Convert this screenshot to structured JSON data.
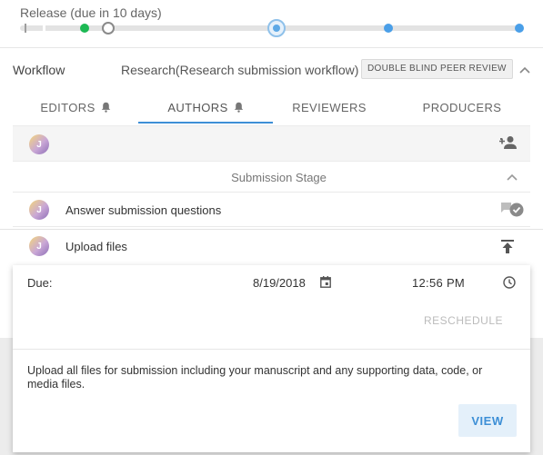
{
  "release": {
    "label": "Release (due in 10 days)"
  },
  "workflow": {
    "label": "Workflow",
    "name": "Research(Research submission workflow)",
    "review_type": "DOUBLE BLIND PEER REVIEW"
  },
  "tabs": [
    {
      "label": "EDITORS",
      "has_bell": true,
      "active": false
    },
    {
      "label": "AUTHORS",
      "has_bell": true,
      "active": true
    },
    {
      "label": "REVIEWERS",
      "has_bell": false,
      "active": false
    },
    {
      "label": "PRODUCERS",
      "has_bell": false,
      "active": false
    }
  ],
  "participants": {
    "avatar_initial": "J",
    "add_icon": "person-add-icon"
  },
  "stage": {
    "title": "Submission Stage",
    "tasks": [
      {
        "avatar_initial": "J",
        "label": "Answer submission questions",
        "icon": "done-comment-icon"
      },
      {
        "avatar_initial": "J",
        "label": "Upload files",
        "icon": "upload-icon"
      }
    ]
  },
  "task_detail": {
    "due_label": "Due:",
    "due_date": "8/19/2018",
    "due_time": "12:56 PM",
    "reschedule_label": "RESCHEDULE",
    "description": "Upload all files for submission including your manuscript and any supporting data, code, or media files.",
    "view_label": "VIEW"
  },
  "colors": {
    "accent": "#3d8fd6",
    "milestone_done": "#1db954",
    "milestone_upcoming": "#4a9fe8"
  }
}
